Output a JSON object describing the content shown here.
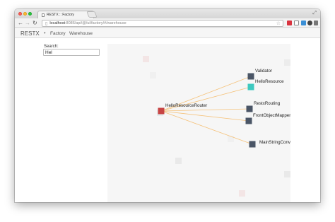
{
  "browser": {
    "tab_title": "RESTX :: Factory",
    "url_host": "localhost",
    "url_path": ":8086/api/@/ui/factory/#/warehouse"
  },
  "app": {
    "brand": "RESTX",
    "nav": [
      "Factory",
      "Warehouse"
    ]
  },
  "search": {
    "label": "Search:",
    "value": "Hel"
  },
  "graph": {
    "edge_color": "#f5c27a",
    "selected_node_color": "#c74444",
    "node_color": "#4a5566",
    "highlight_node_color": "#3ec9c0",
    "source": {
      "label": "HelloResourceRouter"
    },
    "targets": [
      {
        "label": "Validator",
        "highlight": false
      },
      {
        "label": "HelloResource",
        "highlight": true
      },
      {
        "label": "RestxRouting",
        "highlight": false
      },
      {
        "label": "FrontObjectMapper[ObjectM",
        "highlight": false
      },
      {
        "label": "MainStringConverter",
        "highlight": false
      }
    ]
  }
}
